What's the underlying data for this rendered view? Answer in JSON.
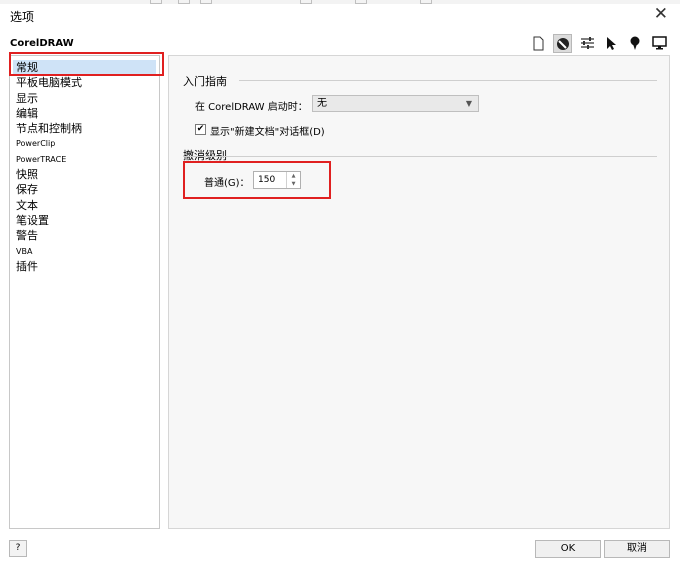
{
  "window": {
    "title": "选项",
    "close_glyph": "✕"
  },
  "app_name": "CorelDRAW",
  "toolbar": {
    "icons": [
      "document-icon",
      "no-entry-icon",
      "sliders-icon",
      "pointer-icon",
      "pin-icon",
      "monitor-icon"
    ],
    "active_index": 1
  },
  "nav": {
    "items": [
      "常规",
      "平板电脑模式",
      "显示",
      "编辑",
      "节点和控制柄",
      "PowerClip",
      "PowerTRACE",
      "快照",
      "保存",
      "文本",
      "笔设置",
      "警告",
      "VBA",
      "插件"
    ],
    "selected_index": 0
  },
  "getting_started": {
    "title": "入门指南",
    "startup_label": "在 CorelDRAW 启动时：",
    "startup_value": "无",
    "show_dialog_label": "显示\"新建文档\"对话框(D)",
    "show_dialog_checked": true
  },
  "undo": {
    "title": "撤消级别",
    "normal_label": "普通(G)：",
    "normal_value": "150"
  },
  "footer": {
    "help_label": "?",
    "ok_label": "OK",
    "cancel_label": "取消"
  },
  "colors": {
    "highlight": "#e02020",
    "selection": "#cfe3f7"
  }
}
